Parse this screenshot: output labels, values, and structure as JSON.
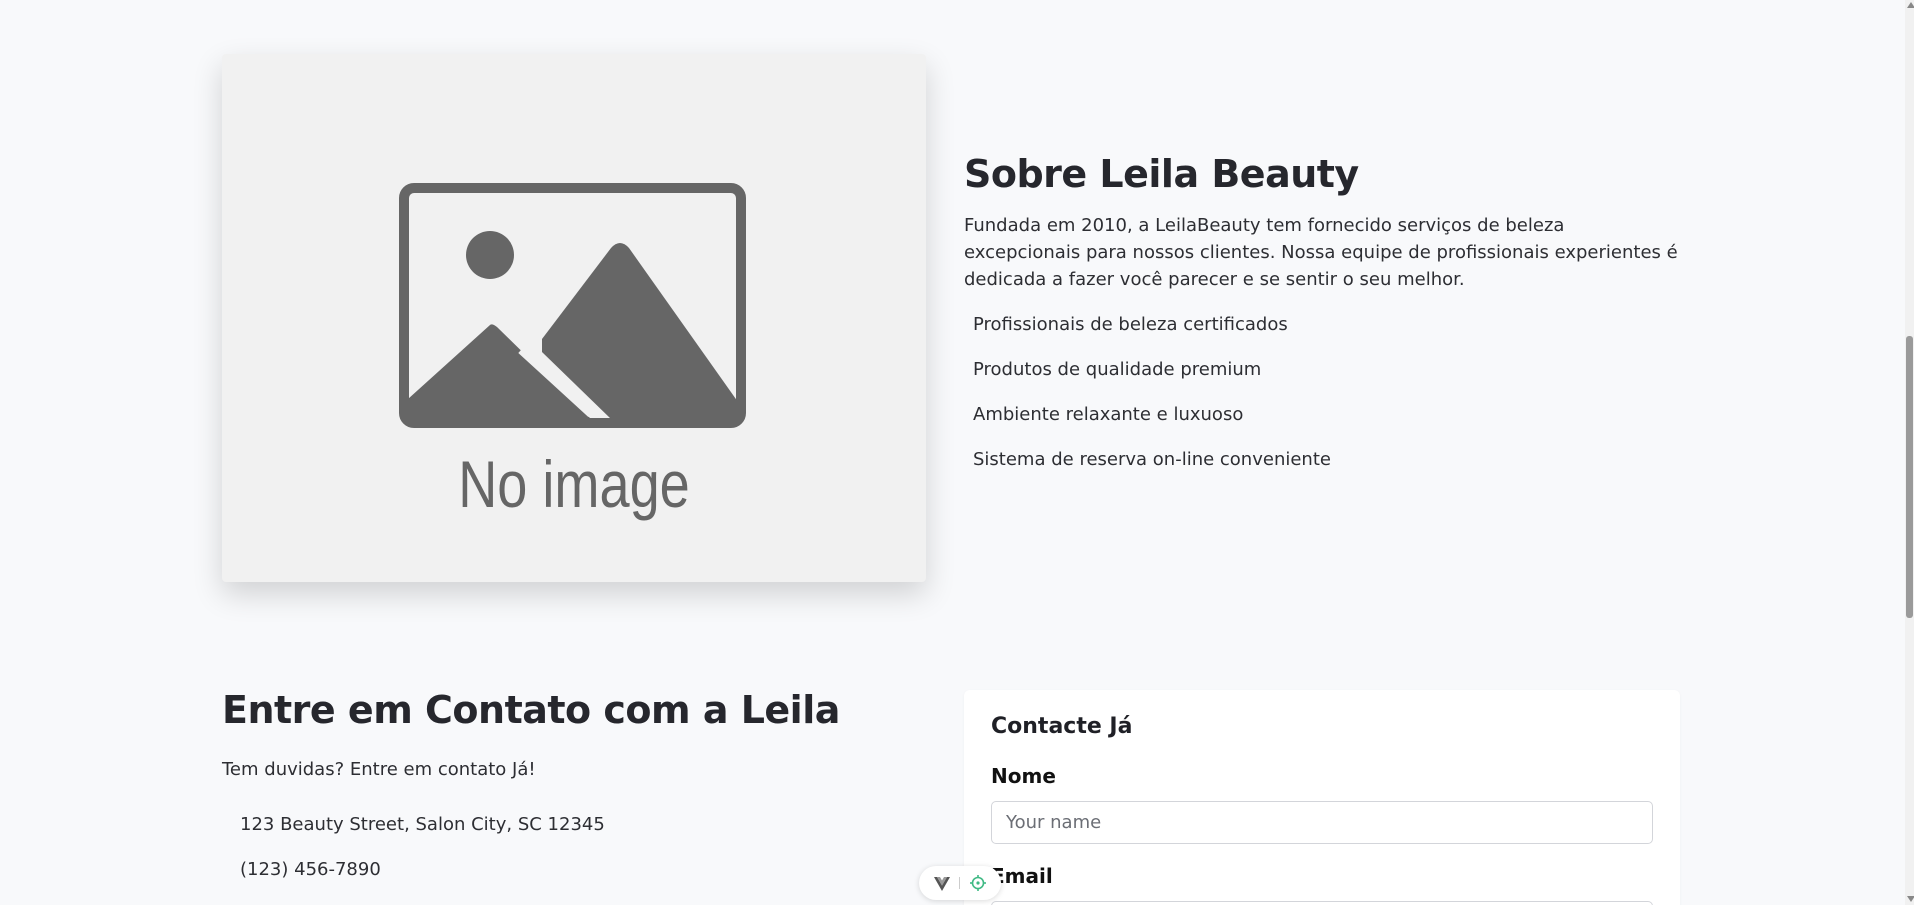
{
  "about": {
    "image_placeholder_text": "No image",
    "title": "Sobre Leila Beauty",
    "description": "Fundada em 2010, a LeilaBeauty tem fornecido serviços de beleza excepcionais para nossos clientes. Nossa equipe de profissionais experientes é dedicada a fazer você parecer e se sentir o seu melhor.",
    "features": [
      "Profissionais de beleza certificados",
      "Produtos de qualidade premium",
      "Ambiente relaxante e luxuoso",
      "Sistema de reserva on-line conveniente"
    ]
  },
  "contact": {
    "title": "Entre em Contato com a Leila",
    "description": "Tem duvidas? Entre em contato Já!",
    "address": "123 Beauty Street, Salon City, SC 12345",
    "phone": "(123) 456-7890"
  },
  "form": {
    "title": "Contacte Já",
    "name_label": "Nome",
    "name_placeholder": "Your name",
    "email_label": "Email"
  },
  "dev_toolbar": {
    "icons": [
      "vue-logo-icon",
      "target-icon"
    ]
  },
  "colors": {
    "page_background": "#f8f9fb",
    "heading": "#26272d",
    "body_text": "#2d2e33",
    "card_background": "#ffffff",
    "placeholder_image_bg": "#f1f1f1",
    "placeholder_image_fg": "#666666"
  }
}
